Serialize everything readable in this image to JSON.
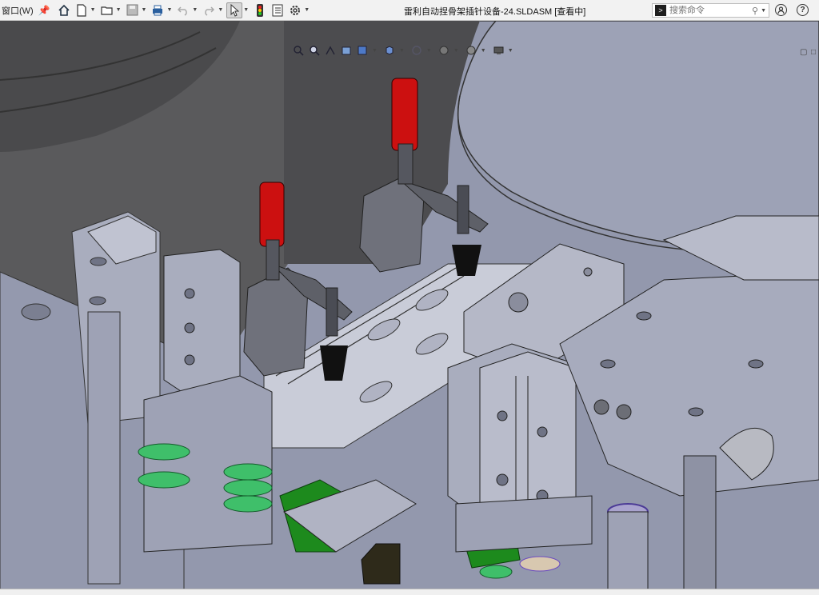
{
  "menu": {
    "window_label": "窗口(W)"
  },
  "toolbar": {
    "icons": [
      "home-icon",
      "new-document-icon",
      "open-folder-icon",
      "save-icon",
      "print-icon",
      "undo-icon",
      "redo-icon",
      "select-cursor-icon",
      "traffic-light-icon",
      "file-properties-icon",
      "options-gear-icon"
    ]
  },
  "window": {
    "title": "雷利自动捏骨架插针设备-24.SLDASM [查看中]"
  },
  "search": {
    "placeholder": "搜索命令"
  },
  "colors": {
    "background": "#9297ab",
    "clamp_handle": "#cc1010",
    "pcb": "#1d8a1d",
    "spring": "#3fbf6a",
    "rubber_tip": "#111111"
  },
  "viewport": {
    "heads_up_icons": [
      "zoom-to-fit-icon",
      "zoom-area-icon",
      "previous-view-icon",
      "section-view-icon",
      "view-orientation-icon",
      "display-style-icon",
      "hide-show-icon",
      "edit-appearance-icon",
      "apply-scene-icon",
      "view-settings-icon"
    ]
  }
}
